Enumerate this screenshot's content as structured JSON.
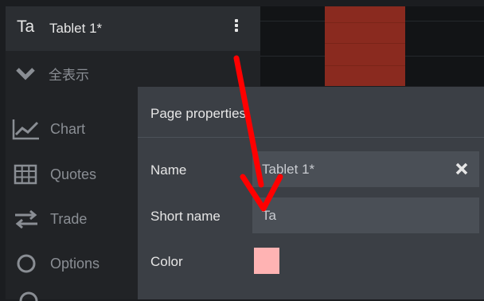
{
  "sidebar": {
    "short_name": "Ta",
    "title": "Tablet 1*",
    "filter_label": "全表示",
    "nav": [
      {
        "label": "Chart",
        "icon": "chart-icon"
      },
      {
        "label": "Quotes",
        "icon": "table-icon"
      },
      {
        "label": "Trade",
        "icon": "transfer-arrows-icon"
      },
      {
        "label": "Options",
        "icon": "circle-icon"
      }
    ]
  },
  "dialog": {
    "title": "Page properties",
    "name_label": "Name",
    "name_value": "Tablet 1*",
    "short_name_label": "Short name",
    "short_name_value": "Ta",
    "color_label": "Color",
    "color_value": "#ffb3b3"
  },
  "colors": {
    "annotation_arrow": "#ff0000",
    "chart_bar": "#8a2a1f"
  }
}
